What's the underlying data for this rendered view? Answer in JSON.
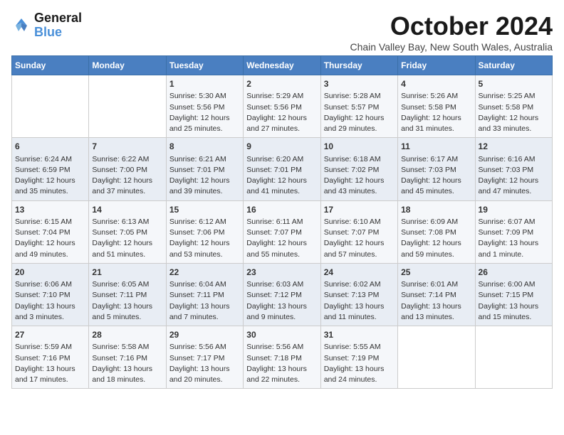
{
  "header": {
    "logo_line1": "General",
    "logo_line2": "Blue",
    "month_title": "October 2024",
    "location": "Chain Valley Bay, New South Wales, Australia"
  },
  "days_of_week": [
    "Sunday",
    "Monday",
    "Tuesday",
    "Wednesday",
    "Thursday",
    "Friday",
    "Saturday"
  ],
  "weeks": [
    [
      {
        "day": "",
        "sunrise": "",
        "sunset": "",
        "daylight": ""
      },
      {
        "day": "",
        "sunrise": "",
        "sunset": "",
        "daylight": ""
      },
      {
        "day": "1",
        "sunrise": "Sunrise: 5:30 AM",
        "sunset": "Sunset: 5:56 PM",
        "daylight": "Daylight: 12 hours and 25 minutes."
      },
      {
        "day": "2",
        "sunrise": "Sunrise: 5:29 AM",
        "sunset": "Sunset: 5:56 PM",
        "daylight": "Daylight: 12 hours and 27 minutes."
      },
      {
        "day": "3",
        "sunrise": "Sunrise: 5:28 AM",
        "sunset": "Sunset: 5:57 PM",
        "daylight": "Daylight: 12 hours and 29 minutes."
      },
      {
        "day": "4",
        "sunrise": "Sunrise: 5:26 AM",
        "sunset": "Sunset: 5:58 PM",
        "daylight": "Daylight: 12 hours and 31 minutes."
      },
      {
        "day": "5",
        "sunrise": "Sunrise: 5:25 AM",
        "sunset": "Sunset: 5:58 PM",
        "daylight": "Daylight: 12 hours and 33 minutes."
      }
    ],
    [
      {
        "day": "6",
        "sunrise": "Sunrise: 6:24 AM",
        "sunset": "Sunset: 6:59 PM",
        "daylight": "Daylight: 12 hours and 35 minutes."
      },
      {
        "day": "7",
        "sunrise": "Sunrise: 6:22 AM",
        "sunset": "Sunset: 7:00 PM",
        "daylight": "Daylight: 12 hours and 37 minutes."
      },
      {
        "day": "8",
        "sunrise": "Sunrise: 6:21 AM",
        "sunset": "Sunset: 7:01 PM",
        "daylight": "Daylight: 12 hours and 39 minutes."
      },
      {
        "day": "9",
        "sunrise": "Sunrise: 6:20 AM",
        "sunset": "Sunset: 7:01 PM",
        "daylight": "Daylight: 12 hours and 41 minutes."
      },
      {
        "day": "10",
        "sunrise": "Sunrise: 6:18 AM",
        "sunset": "Sunset: 7:02 PM",
        "daylight": "Daylight: 12 hours and 43 minutes."
      },
      {
        "day": "11",
        "sunrise": "Sunrise: 6:17 AM",
        "sunset": "Sunset: 7:03 PM",
        "daylight": "Daylight: 12 hours and 45 minutes."
      },
      {
        "day": "12",
        "sunrise": "Sunrise: 6:16 AM",
        "sunset": "Sunset: 7:03 PM",
        "daylight": "Daylight: 12 hours and 47 minutes."
      }
    ],
    [
      {
        "day": "13",
        "sunrise": "Sunrise: 6:15 AM",
        "sunset": "Sunset: 7:04 PM",
        "daylight": "Daylight: 12 hours and 49 minutes."
      },
      {
        "day": "14",
        "sunrise": "Sunrise: 6:13 AM",
        "sunset": "Sunset: 7:05 PM",
        "daylight": "Daylight: 12 hours and 51 minutes."
      },
      {
        "day": "15",
        "sunrise": "Sunrise: 6:12 AM",
        "sunset": "Sunset: 7:06 PM",
        "daylight": "Daylight: 12 hours and 53 minutes."
      },
      {
        "day": "16",
        "sunrise": "Sunrise: 6:11 AM",
        "sunset": "Sunset: 7:07 PM",
        "daylight": "Daylight: 12 hours and 55 minutes."
      },
      {
        "day": "17",
        "sunrise": "Sunrise: 6:10 AM",
        "sunset": "Sunset: 7:07 PM",
        "daylight": "Daylight: 12 hours and 57 minutes."
      },
      {
        "day": "18",
        "sunrise": "Sunrise: 6:09 AM",
        "sunset": "Sunset: 7:08 PM",
        "daylight": "Daylight: 12 hours and 59 minutes."
      },
      {
        "day": "19",
        "sunrise": "Sunrise: 6:07 AM",
        "sunset": "Sunset: 7:09 PM",
        "daylight": "Daylight: 13 hours and 1 minute."
      }
    ],
    [
      {
        "day": "20",
        "sunrise": "Sunrise: 6:06 AM",
        "sunset": "Sunset: 7:10 PM",
        "daylight": "Daylight: 13 hours and 3 minutes."
      },
      {
        "day": "21",
        "sunrise": "Sunrise: 6:05 AM",
        "sunset": "Sunset: 7:11 PM",
        "daylight": "Daylight: 13 hours and 5 minutes."
      },
      {
        "day": "22",
        "sunrise": "Sunrise: 6:04 AM",
        "sunset": "Sunset: 7:11 PM",
        "daylight": "Daylight: 13 hours and 7 minutes."
      },
      {
        "day": "23",
        "sunrise": "Sunrise: 6:03 AM",
        "sunset": "Sunset: 7:12 PM",
        "daylight": "Daylight: 13 hours and 9 minutes."
      },
      {
        "day": "24",
        "sunrise": "Sunrise: 6:02 AM",
        "sunset": "Sunset: 7:13 PM",
        "daylight": "Daylight: 13 hours and 11 minutes."
      },
      {
        "day": "25",
        "sunrise": "Sunrise: 6:01 AM",
        "sunset": "Sunset: 7:14 PM",
        "daylight": "Daylight: 13 hours and 13 minutes."
      },
      {
        "day": "26",
        "sunrise": "Sunrise: 6:00 AM",
        "sunset": "Sunset: 7:15 PM",
        "daylight": "Daylight: 13 hours and 15 minutes."
      }
    ],
    [
      {
        "day": "27",
        "sunrise": "Sunrise: 5:59 AM",
        "sunset": "Sunset: 7:16 PM",
        "daylight": "Daylight: 13 hours and 17 minutes."
      },
      {
        "day": "28",
        "sunrise": "Sunrise: 5:58 AM",
        "sunset": "Sunset: 7:16 PM",
        "daylight": "Daylight: 13 hours and 18 minutes."
      },
      {
        "day": "29",
        "sunrise": "Sunrise: 5:56 AM",
        "sunset": "Sunset: 7:17 PM",
        "daylight": "Daylight: 13 hours and 20 minutes."
      },
      {
        "day": "30",
        "sunrise": "Sunrise: 5:56 AM",
        "sunset": "Sunset: 7:18 PM",
        "daylight": "Daylight: 13 hours and 22 minutes."
      },
      {
        "day": "31",
        "sunrise": "Sunrise: 5:55 AM",
        "sunset": "Sunset: 7:19 PM",
        "daylight": "Daylight: 13 hours and 24 minutes."
      },
      {
        "day": "",
        "sunrise": "",
        "sunset": "",
        "daylight": ""
      },
      {
        "day": "",
        "sunrise": "",
        "sunset": "",
        "daylight": ""
      }
    ]
  ]
}
